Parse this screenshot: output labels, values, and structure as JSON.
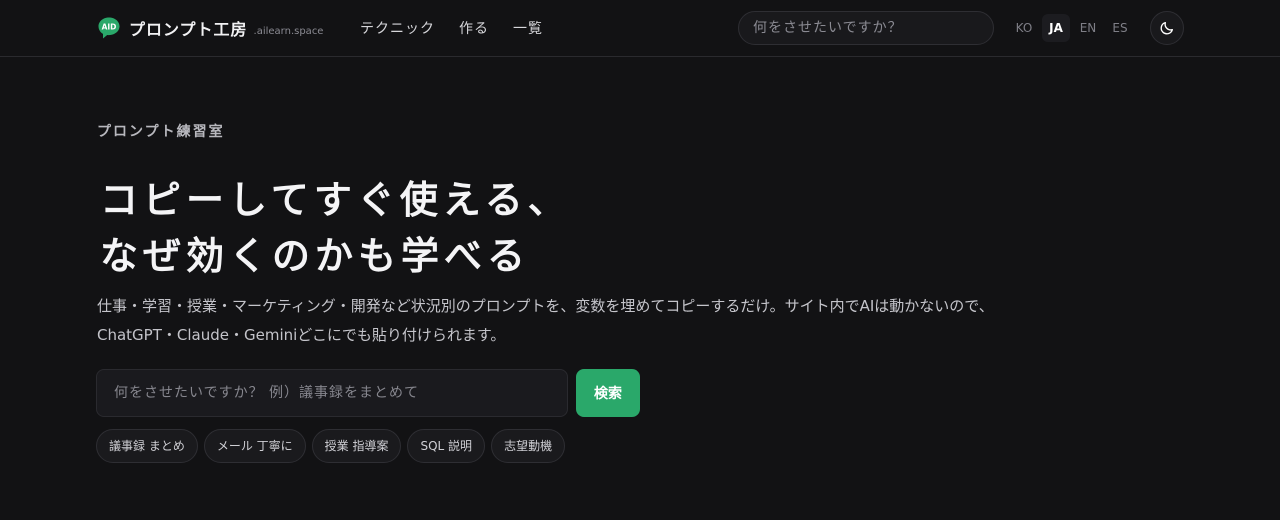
{
  "header": {
    "logo_name": "プロンプト工房",
    "logo_domain": ".ailearn.space",
    "logo_icon_text": "AID",
    "nav": [
      {
        "label": "テクニック"
      },
      {
        "label": "作る"
      },
      {
        "label": "一覧"
      }
    ],
    "search_placeholder": "何をさせたいですか？",
    "languages": [
      "KO",
      "JA",
      "EN",
      "ES"
    ],
    "active_language": "JA",
    "theme_toggle_icon": "moon-icon"
  },
  "hero": {
    "eyebrow": "プロンプト練習室",
    "title_lines": [
      "コピーしてすぐ使える、",
      "なぜ効くのかも学べる"
    ],
    "description_lines": [
      "仕事・学習・授業・マーケティング・開発など状況別のプロンプトを、変数を埋めてコピーするだけ。サイト内でAIは動かないので、",
      "ChatGPT・Claude・Geminiどこにでも貼り付けられます。"
    ],
    "search_placeholder": "何をさせたいですか？ 例）議事録をまとめて",
    "search_button": "検索",
    "chips": [
      "議事録 まとめ",
      "メール 丁寧に",
      "授業 指導案",
      "SQL 説明",
      "志望動機"
    ]
  },
  "colors": {
    "background": "#121214",
    "accent": "#2aa86a"
  }
}
